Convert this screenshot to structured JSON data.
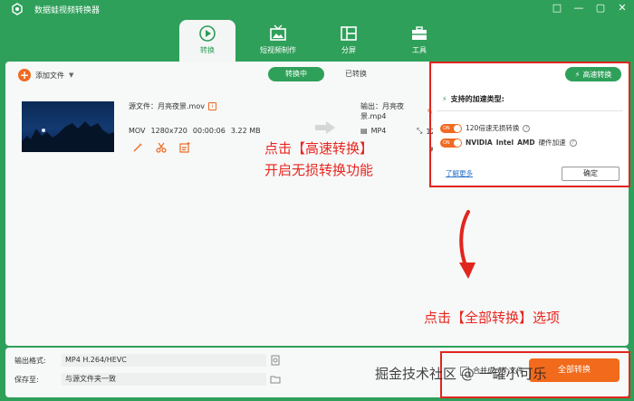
{
  "app": {
    "title": "数据蛙视频转换器",
    "logo_icon": "app-logo-icon"
  },
  "window_controls": [
    "□",
    "—",
    "▢",
    "✕"
  ],
  "nav": {
    "tabs": [
      {
        "label": "转换",
        "icon": "convert-icon",
        "active": true
      },
      {
        "label": "短视频制作",
        "icon": "tv-icon",
        "active": false
      },
      {
        "label": "分屏",
        "icon": "split-screen-icon",
        "active": false
      },
      {
        "label": "工具",
        "icon": "toolbox-icon",
        "active": false
      }
    ]
  },
  "toolbar": {
    "add_file": "添加文件",
    "segments": {
      "converting": "转换中",
      "converted": "已转换"
    }
  },
  "file": {
    "source_name": "源文件：月亮夜景.mov",
    "format": "MOV",
    "resolution": "1280x720",
    "duration": "00:00:06",
    "size": "3.22 MB",
    "output_name": "输出：月亮夜景.mp4",
    "output_format": "MP4",
    "output_resolution": "1280"
  },
  "popup": {
    "high_speed_label": "高速转换",
    "header": "支持的加速类型:",
    "toggle_on": "ON",
    "row1": "120倍速无损转换",
    "row2_nvidia": "NVIDIA",
    "row2_intel": "Intel",
    "row2_amd": "AMD",
    "row2_suffix": "硬件加速",
    "learn_more": "了解更多",
    "ok": "确定"
  },
  "annotations": {
    "line1": "点击【高速转换】",
    "line2": "开启无损转换功能",
    "line3": "点击【全部转换】选项"
  },
  "bottom": {
    "output_format_label": "输出格式:",
    "output_format_value": "MP4 H.264/HEVC",
    "save_to_label": "保存至:",
    "save_to_value": "与源文件夹一致",
    "merge_label": "合并成一个文件",
    "convert_all": "全部转换"
  },
  "watermark": "掘金技术社区 @ 一罐小可乐",
  "colors": {
    "brand_green": "#2fa05a",
    "accent_orange": "#f06a22",
    "highlight_red": "#e0261e"
  }
}
